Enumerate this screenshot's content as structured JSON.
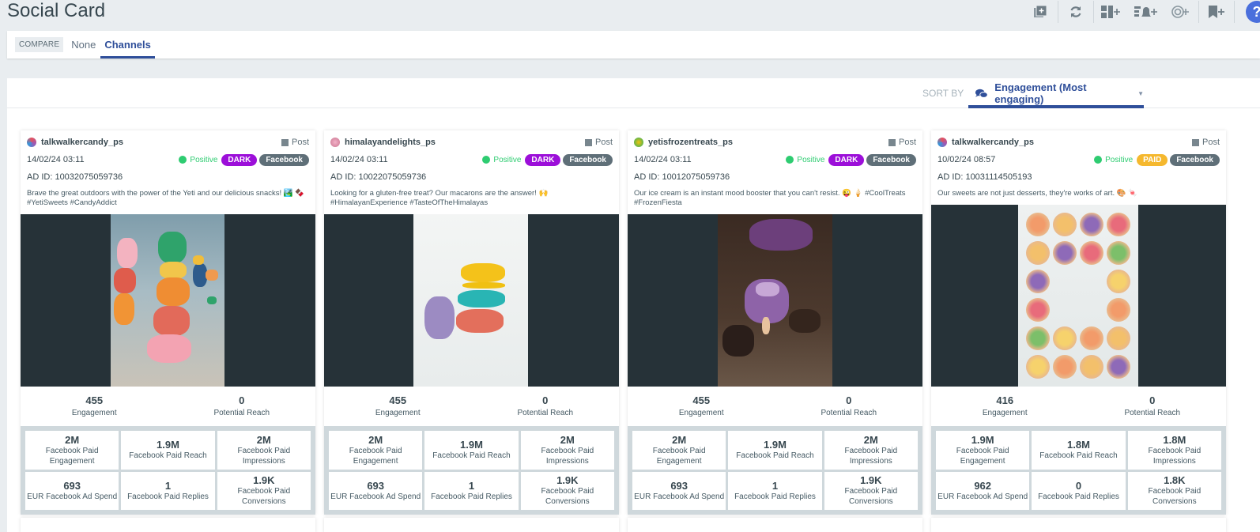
{
  "page": {
    "title": "Social Card"
  },
  "toolbar": {
    "items": [
      {
        "name": "add-widget-icon"
      },
      {
        "name": "refresh-icon"
      },
      {
        "name": "add-dashboard-icon"
      },
      {
        "name": "add-alert-icon"
      },
      {
        "name": "add-report-icon"
      },
      {
        "name": "add-bookmark-icon"
      }
    ],
    "help_label": "?"
  },
  "compare": {
    "label": "COMPARE",
    "options": [
      {
        "label": "None",
        "active": false
      },
      {
        "label": "Channels",
        "active": true
      }
    ]
  },
  "sort": {
    "label": "SORT BY",
    "value": "Engagement (Most engaging)"
  },
  "cards": [
    {
      "author": "talkwalkercandy_ps",
      "post_type": "Post",
      "date": "14/02/24 03:11",
      "sentiment": "Positive",
      "ad_type": "DARK",
      "channel": "Facebook",
      "ad_id": "AD ID: 10032075059736",
      "text": "Brave the great outdoors with the power of the Yeti and our delicious snacks! 🏞️ 🍫 #YetiSweets #CandyAddict",
      "engagement": "455",
      "engagement_label": "Engagement",
      "reach": "0",
      "reach_label": "Potential Reach",
      "metrics": [
        {
          "value": "2M",
          "label": "Facebook Paid Engagement"
        },
        {
          "value": "1.9M",
          "label": "Facebook Paid Reach"
        },
        {
          "value": "2M",
          "label": "Facebook Paid Impressions"
        },
        {
          "value": "693",
          "label": "EUR Facebook Ad Spend"
        },
        {
          "value": "1",
          "label": "Facebook Paid Replies"
        },
        {
          "value": "1.9K",
          "label": "Facebook Paid Conversions"
        }
      ]
    },
    {
      "author": "himalayandelights_ps",
      "post_type": "Post",
      "date": "14/02/24 03:11",
      "sentiment": "Positive",
      "ad_type": "DARK",
      "channel": "Facebook",
      "ad_id": "AD ID: 10022075059736",
      "text": "Looking for a gluten-free treat? Our macarons are the answer! 🙌 #HimalayanExperience #TasteOfTheHimalayas",
      "engagement": "455",
      "engagement_label": "Engagement",
      "reach": "0",
      "reach_label": "Potential Reach",
      "metrics": [
        {
          "value": "2M",
          "label": "Facebook Paid Engagement"
        },
        {
          "value": "1.9M",
          "label": "Facebook Paid Reach"
        },
        {
          "value": "2M",
          "label": "Facebook Paid Impressions"
        },
        {
          "value": "693",
          "label": "EUR Facebook Ad Spend"
        },
        {
          "value": "1",
          "label": "Facebook Paid Replies"
        },
        {
          "value": "1.9K",
          "label": "Facebook Paid Conversions"
        }
      ]
    },
    {
      "author": "yetisfrozentreats_ps",
      "post_type": "Post",
      "date": "14/02/24 03:11",
      "sentiment": "Positive",
      "ad_type": "DARK",
      "channel": "Facebook",
      "ad_id": "AD ID: 10012075059736",
      "text": "Our ice cream is an instant mood booster that you can't resist. 😜 🍦 #CoolTreats #FrozenFiesta",
      "engagement": "455",
      "engagement_label": "Engagement",
      "reach": "0",
      "reach_label": "Potential Reach",
      "metrics": [
        {
          "value": "2M",
          "label": "Facebook Paid Engagement"
        },
        {
          "value": "1.9M",
          "label": "Facebook Paid Reach"
        },
        {
          "value": "2M",
          "label": "Facebook Paid Impressions"
        },
        {
          "value": "693",
          "label": "EUR Facebook Ad Spend"
        },
        {
          "value": "1",
          "label": "Facebook Paid Replies"
        },
        {
          "value": "1.9K",
          "label": "Facebook Paid Conversions"
        }
      ]
    },
    {
      "author": "talkwalkercandy_ps",
      "post_type": "Post",
      "date": "10/02/24 08:57",
      "sentiment": "Positive",
      "ad_type": "PAID",
      "channel": "Facebook",
      "ad_id": "AD ID: 10031114505193",
      "text": "Our sweets are not just desserts, they're works of art. 🎨 🍬",
      "engagement": "416",
      "engagement_label": "Engagement",
      "reach": "0",
      "reach_label": "Potential Reach",
      "metrics": [
        {
          "value": "1.9M",
          "label": "Facebook Paid Engagement"
        },
        {
          "value": "1.8M",
          "label": "Facebook Paid Reach"
        },
        {
          "value": "1.8M",
          "label": "Facebook Paid Impressions"
        },
        {
          "value": "962",
          "label": "EUR Facebook Ad Spend"
        },
        {
          "value": "0",
          "label": "Facebook Paid Replies"
        },
        {
          "value": "1.8K",
          "label": "Facebook Paid Conversions"
        }
      ]
    }
  ]
}
